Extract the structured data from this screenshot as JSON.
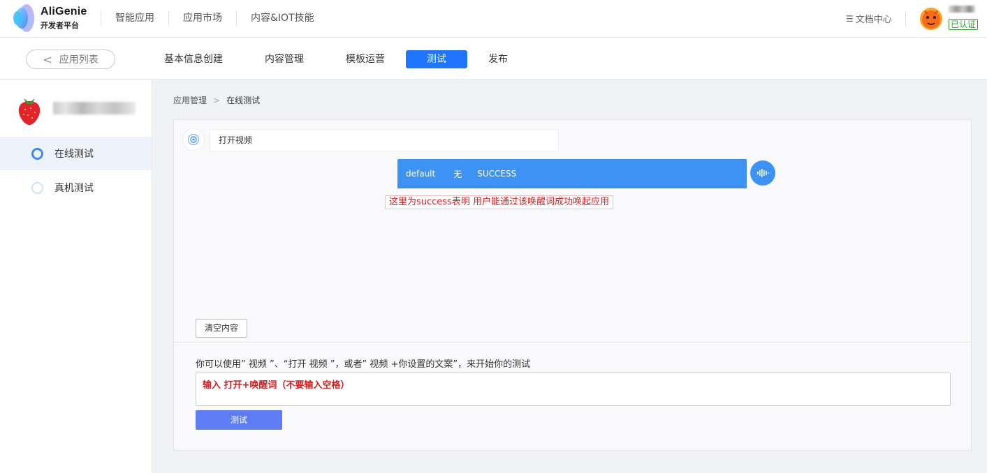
{
  "brand": {
    "name": "AliGenie",
    "subtitle": "开发者平台"
  },
  "top_nav": [
    "智能应用",
    "应用市场",
    "内容&IOT技能"
  ],
  "header_right": {
    "docs_label": "文档中心",
    "verified_label": "已认证"
  },
  "steps": {
    "back_label": "应用列表",
    "items": [
      "基本信息创建",
      "内容管理",
      "模板运营",
      "测试",
      "发布"
    ],
    "active": "测试"
  },
  "sidebar": {
    "items": [
      {
        "label": "在线测试",
        "active": true
      },
      {
        "label": "真机测试",
        "active": false
      }
    ]
  },
  "breadcrumb": {
    "parent": "应用管理",
    "current": "在线测试"
  },
  "chat": {
    "user_message": "打开视频",
    "reply": {
      "intent": "default",
      "slot": "无",
      "status": "SUCCESS"
    },
    "annotation": "这里为success表明 用户能通过该唤醒词成功唤起应用"
  },
  "controls": {
    "clear_label": "清空内容",
    "hint": "你可以使用” 视频 ”、“打开 视频 ”，或者” 视频 +你设置的文案”，来开始你的测试",
    "input_value": "输入 打开+唤醒词（不要输入空格）",
    "test_label": "测试"
  },
  "colors": {
    "primary": "#1f75fe",
    "reply_bg": "#3d93f3",
    "test_button": "#5e7df5",
    "annotation": "#e02020",
    "verified": "#2aa52a"
  }
}
